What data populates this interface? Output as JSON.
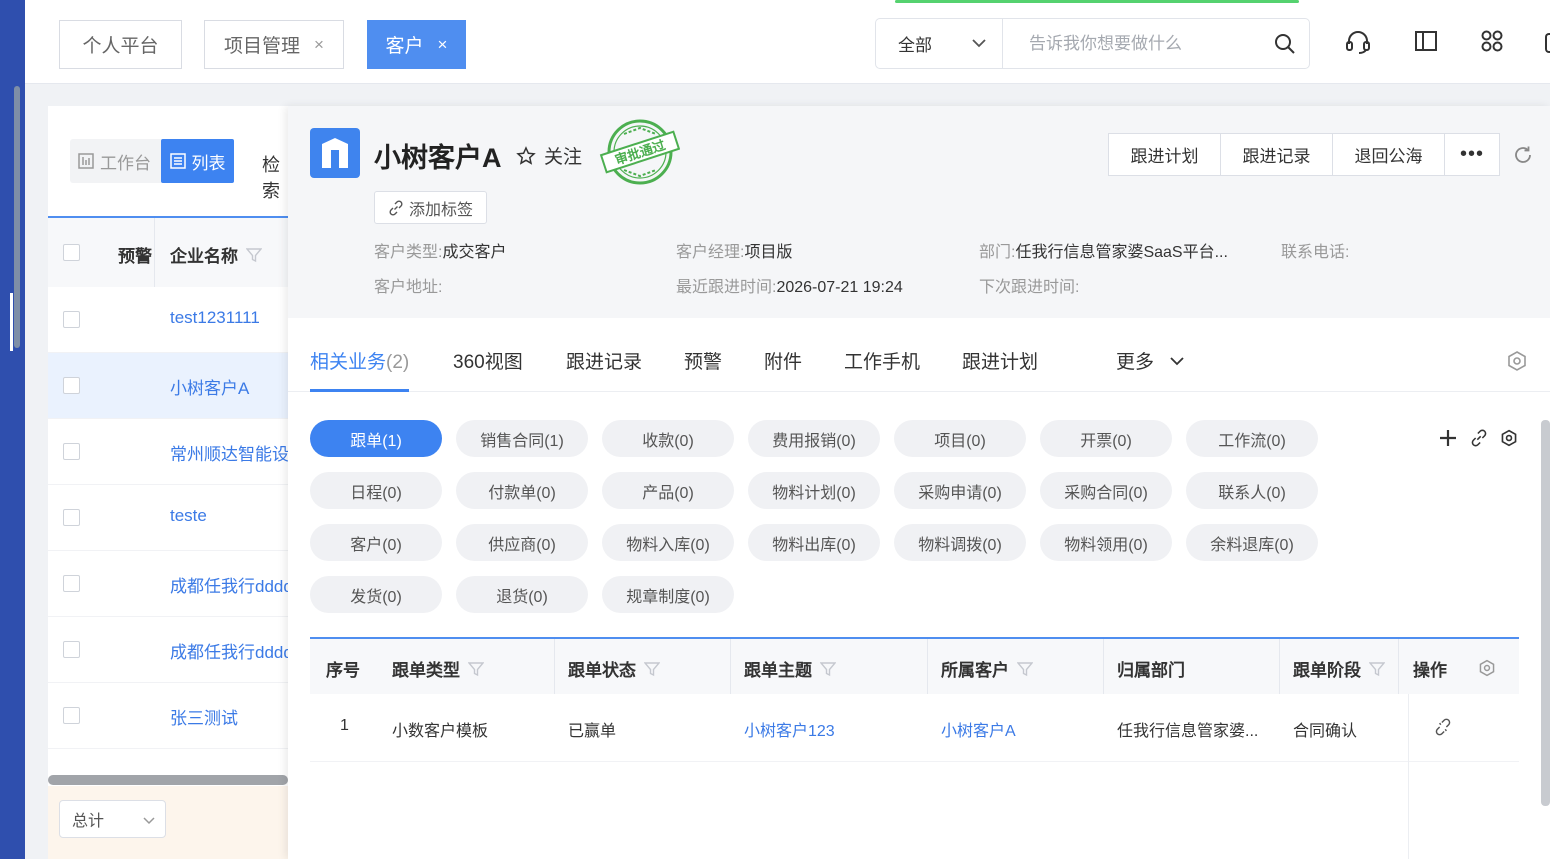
{
  "topbar": {
    "tabs": [
      {
        "label": "个人平台",
        "closable": false
      },
      {
        "label": "项目管理",
        "closable": true
      },
      {
        "label": "客户",
        "closable": true,
        "active": true
      }
    ],
    "close_glyph": "×",
    "scope_value": "全部",
    "search_placeholder": "告诉我你想要做什么",
    "icons": [
      "headset-icon",
      "sidebar-layout-icon",
      "apps-grid-icon"
    ]
  },
  "list": {
    "view_workbench": "工作台",
    "view_list": "列表",
    "search_label": "检索",
    "columns": [
      "预警",
      "企业名称"
    ],
    "rows": [
      "test1231111",
      "小树客户A",
      "常州顺达智能设备",
      "teste",
      "成都任我行dddd",
      "成都任我行dddd",
      "张三测试"
    ],
    "selected_index": 1,
    "total_label": "总计"
  },
  "detail": {
    "customer_name": "小树客户A",
    "follow_label": "关注",
    "stamp_text": "审批通过",
    "add_tag_label": "添加标签",
    "info": {
      "type_label": "客户类型:",
      "type_value": "成交客户",
      "manager_label": "客户经理:",
      "manager_value": "项目版",
      "dept_label": "部门:",
      "dept_value": "任我行信息管家婆SaaS平台...",
      "phone_label": "联系电话:",
      "phone_value": "",
      "address_label": "客户地址:",
      "address_value": "",
      "last_follow_label": "最近跟进时间:",
      "last_follow_value": "2026-07-21 19:24",
      "next_follow_label": "下次跟进时间:",
      "next_follow_value": ""
    },
    "actions": [
      "跟进计划",
      "跟进记录",
      "退回公海",
      "•••"
    ],
    "tabs": [
      {
        "label": "相关业务",
        "count": "(2)",
        "active": true
      },
      {
        "label": "360视图"
      },
      {
        "label": "跟进记录"
      },
      {
        "label": "预警"
      },
      {
        "label": "附件"
      },
      {
        "label": "工作手机"
      },
      {
        "label": "跟进计划"
      },
      {
        "label": "更多"
      }
    ],
    "pills": [
      "跟单(1)",
      "销售合同(1)",
      "收款(0)",
      "费用报销(0)",
      "项目(0)",
      "开票(0)",
      "工作流(0)",
      "日程(0)",
      "付款单(0)",
      "产品(0)",
      "物料计划(0)",
      "采购申请(0)",
      "采购合同(0)",
      "联系人(0)",
      "客户(0)",
      "供应商(0)",
      "物料入库(0)",
      "物料出库(0)",
      "物料调拨(0)",
      "物料领用(0)",
      "余料退库(0)",
      "发货(0)",
      "退货(0)",
      "规章制度(0)"
    ],
    "active_pill": 0,
    "table": {
      "headers": [
        "序号",
        "跟单类型",
        "跟单状态",
        "跟单主题",
        "所属客户",
        "归属部门",
        "跟单阶段",
        "操作"
      ],
      "rows": [
        {
          "no": "1",
          "type": "小数客户模板",
          "status": "已赢单",
          "subject": "小树客户123",
          "customer": "小树客户A",
          "dept": "任我行信息管家婆...",
          "stage": "合同确认"
        }
      ]
    }
  },
  "colors": {
    "brand": "#3d83f1",
    "sidebar": "#2f4fae",
    "stamp": "#4caf50"
  }
}
